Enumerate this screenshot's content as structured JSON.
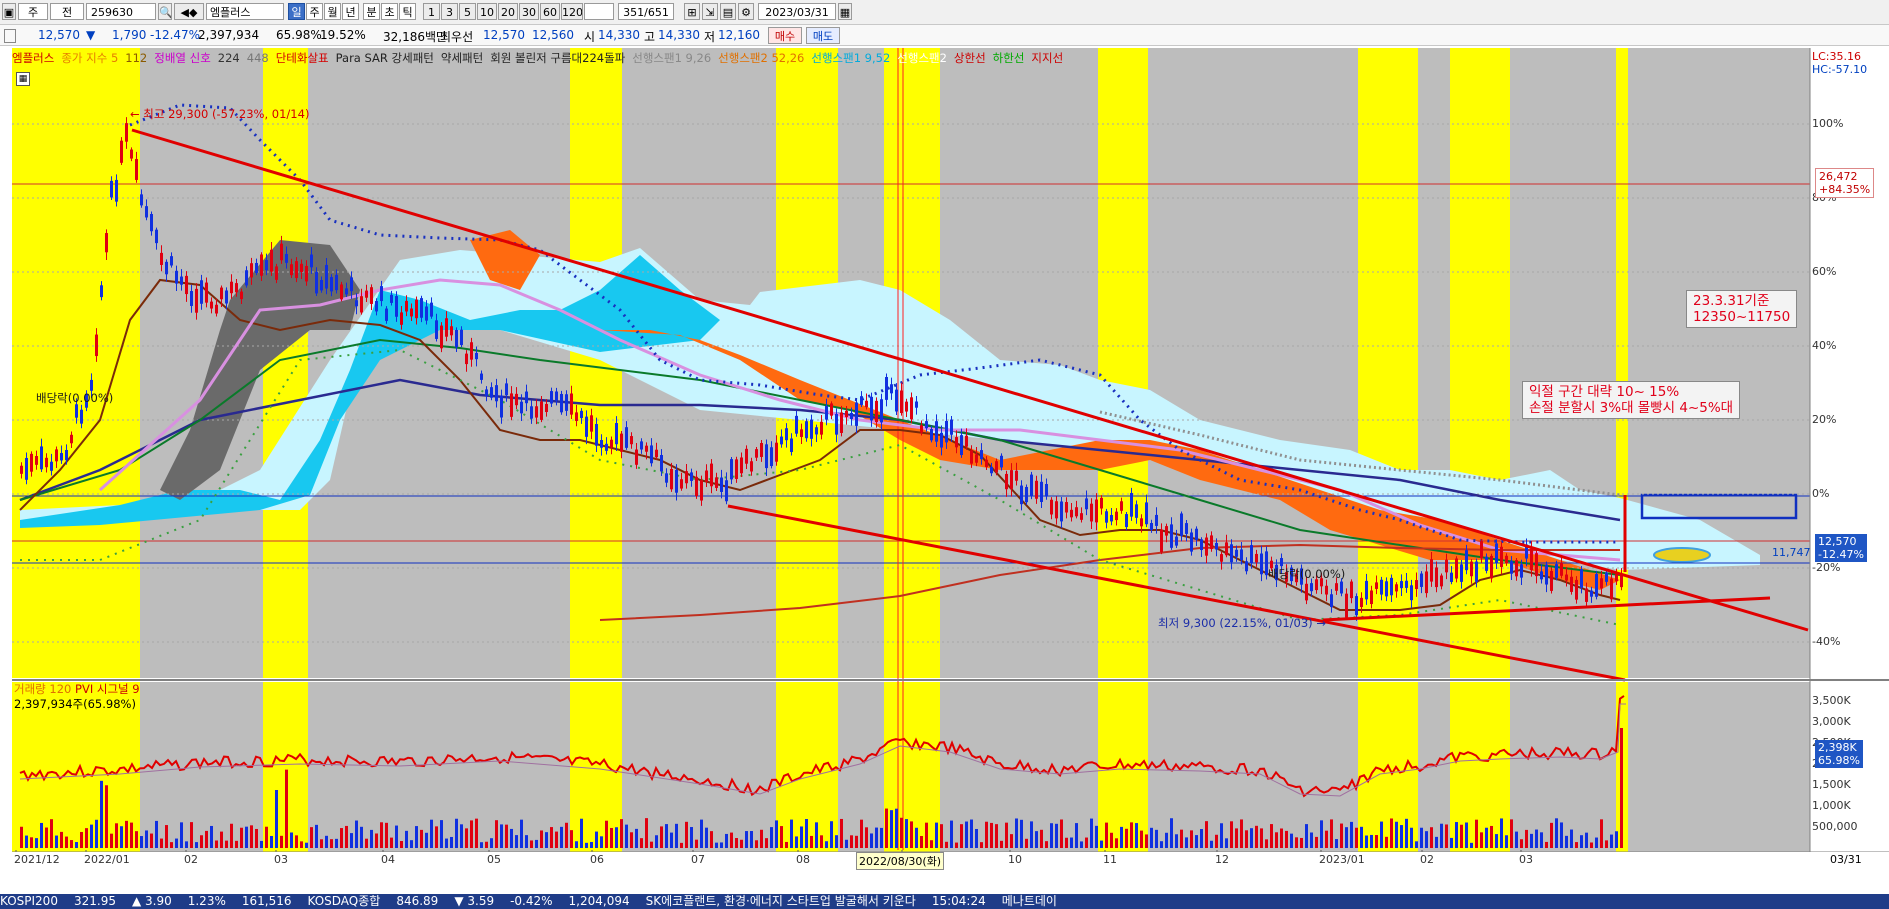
{
  "toolbar": {
    "stock_code": "259630",
    "stock_name": "엠플러스",
    "prefix_1": "주",
    "prefix_2": "전",
    "period_buttons": [
      "일",
      "주",
      "월",
      "년",
      "분",
      "초",
      "틱"
    ],
    "minute_buttons": [
      "1",
      "3",
      "5",
      "10",
      "20",
      "30",
      "60",
      "120"
    ],
    "position_counter": "351/651",
    "date": "2023/03/31"
  },
  "quote": {
    "price": "12,570",
    "change": "1,790",
    "change_pct": "-12.47%",
    "volume": "2,397,934",
    "volume_ratio": "65.98%",
    "turnover": "19.52%",
    "amount": "32,186백만",
    "best_ask_label": "최우선",
    "best_ask": "12,570",
    "best_bid": "12,560",
    "open_label": "시",
    "open": "14,330",
    "high_label": "고",
    "high": "14,330",
    "low_label": "저",
    "low": "12,160",
    "buy_label": "매수",
    "sell_label": "매도"
  },
  "legend": {
    "items": [
      {
        "text": "엠플러스",
        "color": "#cc0000"
      },
      {
        "text": "종가 지수 5",
        "color": "#e67e00"
      },
      {
        "text": "112",
        "color": "#8a5a00"
      },
      {
        "text": "정배열 신호",
        "color": "#cc00cc"
      },
      {
        "text": "224",
        "color": "#333333"
      },
      {
        "text": "448",
        "color": "#777777"
      },
      {
        "text": "단테화살표",
        "color": "#d40000"
      },
      {
        "text": "Para SAR 강세패턴",
        "color": "#222222"
      },
      {
        "text": "약세패턴",
        "color": "#222222"
      },
      {
        "text": "회원 볼린저 구름대224돌파",
        "color": "#222222"
      },
      {
        "text": "선행스팬1 9,26",
        "color": "#888888"
      },
      {
        "text": "선행스팬2 52,26",
        "color": "#e07000"
      },
      {
        "text": "선행스팬1 9,52",
        "color": "#00aadd"
      },
      {
        "text": "선행스팬2",
        "color": "#ffffff"
      },
      {
        "text": "상한선",
        "color": "#cc0000"
      },
      {
        "text": "하한선",
        "color": "#00aa00"
      },
      {
        "text": "지지선",
        "color": "#cc0000"
      }
    ]
  },
  "chart": {
    "ratio_labels": [
      "LC:35.16",
      "HC:-57.10"
    ],
    "pct_ticks": [
      "100%",
      "80%",
      "60%",
      "40%",
      "20%",
      "0%",
      "-20%",
      "-40%"
    ],
    "pct_values": [
      100,
      80,
      60,
      40,
      20,
      0,
      -20,
      -40
    ],
    "x_ticks": [
      "2021/12",
      "2022/01",
      "02",
      "03",
      "04",
      "05",
      "06",
      "07",
      "08",
      "09",
      "10",
      "11",
      "12",
      "2023/01",
      "02",
      "03"
    ],
    "x_end_label": "03/31",
    "crosshair_date": "2022/08/30(화)",
    "high_note": "← 최고 29,300 (-57.23%, 01/14)",
    "low_note": "최저 9,300 (22.15%, 01/03) →",
    "dividend_note_1": "배당락(0.00%)",
    "dividend_note_2": "배당락(0.00%)",
    "price_tag_1": "26,472",
    "price_tag_1b": "+84.35%",
    "price_tag_2": "12,570",
    "price_tag_2b": "-12.47%",
    "price_tag_3": "11,747",
    "note_1": "23.3.31기준\n12350~11750",
    "note_2": "익절 구간 대략 10~ 15%\n손절 분할시 3%대 몰빵시 4~5%대",
    "colors": {
      "highlight": "#ffff00",
      "band": "#c0c0c0",
      "trend": "#e00000"
    }
  },
  "volume_panel": {
    "legend_1": "거래량 120",
    "legend_2": "PVI 시그널 9",
    "legend_3": "2,397,934주(65.98%)",
    "ticks": [
      "3,500K",
      "3,000K",
      "2,500K",
      "2,000K",
      "1,500K",
      "1,000K",
      "500,000"
    ],
    "tag_1": "2,398K",
    "tag_2": "65.98%"
  },
  "statusbar": {
    "items": [
      "KOSPI200",
      "321.95",
      "▲ 3.90",
      "1.23%",
      "161,516",
      "KOSDAQ종합",
      "846.89",
      "▼ 3.59",
      "-0.42%",
      "1,204,094",
      "SK에코플랜트, 환경·에너지 스타트업 발굴해서 키운다",
      "15:04:24",
      "메나트데이"
    ]
  }
}
